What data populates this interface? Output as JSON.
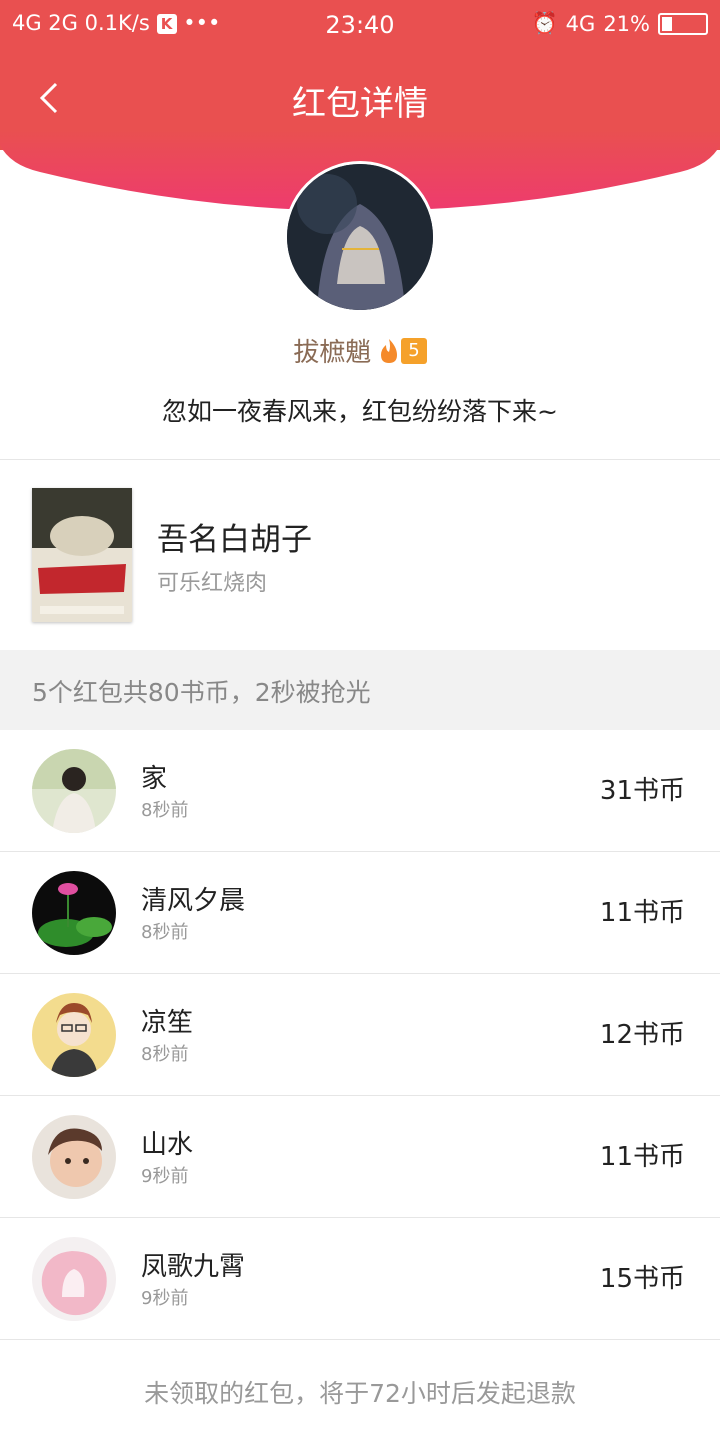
{
  "status_bar": {
    "left": "4G 2G 0.1K/s",
    "k_badge": "K",
    "dots": "•••",
    "time": "23:40",
    "network_right": "4G",
    "battery_text": "21%",
    "battery_level": 0.21
  },
  "header": {
    "title": "红包详情"
  },
  "sender": {
    "name": "拔樜魈",
    "level": "5",
    "message": "忽如一夜春风来，红包纷纷落下来~"
  },
  "book": {
    "title": "吾名白胡子",
    "author": "可乐红烧肉"
  },
  "summary": "5个红包共80书币，2秒被抢光",
  "records": [
    {
      "name": "家",
      "time": "8秒前",
      "amount": "31书币"
    },
    {
      "name": "清风夕晨",
      "time": "8秒前",
      "amount": "11书币"
    },
    {
      "name": "凉笙",
      "time": "8秒前",
      "amount": "12书币"
    },
    {
      "name": "山水",
      "time": "9秒前",
      "amount": "11书币"
    },
    {
      "name": "凤歌九霄",
      "time": "9秒前",
      "amount": "15书币"
    }
  ],
  "footer": "未领取的红包，将于72小时后发起退款",
  "colors": {
    "header": "#e95050",
    "curve": "#ea3f6a",
    "level_badge": "#f5a12a"
  }
}
